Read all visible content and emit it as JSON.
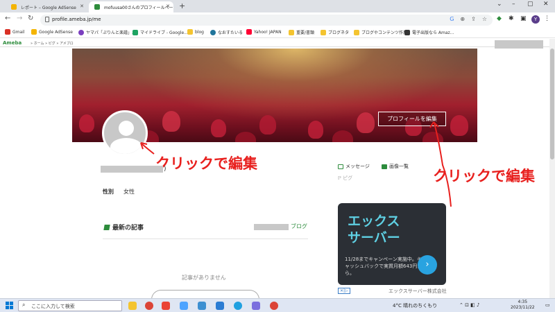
{
  "browser": {
    "tabs": [
      {
        "label": "レポート – Google AdSense",
        "favicon_color": "#f4b400"
      },
      {
        "label": "mofuusa00さんのプロフィールページ",
        "favicon_color": "#2d8c3c"
      }
    ],
    "new_tab": "+",
    "window_controls": [
      "⌄",
      "–",
      "▢",
      "✕"
    ],
    "address": "profile.ameba.jp/me",
    "avatar_letter": "Y"
  },
  "bookmarks": [
    {
      "label": "Gmail",
      "icon": "gmail-icon",
      "color": "#d93025"
    },
    {
      "label": "Google AdSense",
      "icon": "adsense-icon",
      "color": "#f4b400"
    },
    {
      "label": "ヤマパ「ぷりんと楽譜」...",
      "icon": "yamaha-icon",
      "color": "#7b3fbf"
    },
    {
      "label": "マイドライブ - Google...",
      "icon": "drive-icon",
      "color": "#1fa463"
    },
    {
      "label": "blog",
      "icon": "folder-icon",
      "color": "#f4c430"
    },
    {
      "label": "なおすたいる",
      "icon": "wordpress-icon",
      "color": "#21759b"
    },
    {
      "label": "Yahoo! JAPAN",
      "icon": "yahoo-icon",
      "color": "#ff0033"
    },
    {
      "label": "重要/書類",
      "icon": "folder-icon",
      "color": "#f4c430"
    },
    {
      "label": "ブログネタ",
      "icon": "folder-icon",
      "color": "#f4c430"
    },
    {
      "label": "ブログやコンテンツ作用",
      "icon": "folder-icon",
      "color": "#f4c430"
    },
    {
      "label": "電子出版なら Amaz...",
      "icon": "amazon-icon",
      "color": "#333333"
    }
  ],
  "ameba": {
    "logo": "Ameba",
    "crumbs": "» ホーム  » ピグ  » アメブロ"
  },
  "profile": {
    "edit_button": "プロフィールを編集",
    "gender_label": "性別",
    "gender_value": "女性",
    "name_suffix": ")",
    "links": {
      "message": "メッセージ",
      "images": "画像一覧",
      "pigg": "ピグ"
    },
    "recent_title": "最新の記事",
    "blog_link": "ブログ",
    "no_articles": "記事がありません"
  },
  "annotations": {
    "avatar_note": "クリックで編集",
    "edit_note": "クリックで編集"
  },
  "ad": {
    "title": "エックス\nサーバー",
    "body": "11/28までキャンペーン実施中。キャッシュバックで実質月額643円から。",
    "button": "›",
    "mark": "✕|▷",
    "company": "エックスサーバー株式会社"
  },
  "taskbar": {
    "search_placeholder": "ここに入力して検索",
    "weather": "4°C  晴れのちくもり",
    "time": "4:35",
    "date": "2023/11/22"
  },
  "colors": {
    "ameba_green": "#2d8c3c",
    "annotation_red": "#e8201e",
    "ad_accent": "#5fd0e3"
  }
}
